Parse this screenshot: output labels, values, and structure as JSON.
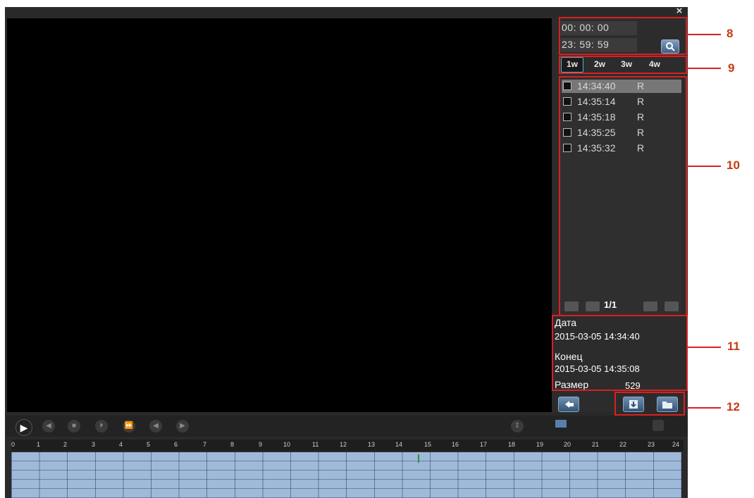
{
  "window": {
    "close_glyph": "×"
  },
  "search": {
    "start_time": "00: 00: 00",
    "end_time": "23: 59: 59",
    "search_icon": "search-icon"
  },
  "week_tabs": [
    "1w",
    "2w",
    "3w",
    "4w"
  ],
  "records": [
    {
      "time": "14:34:40",
      "flag": "R"
    },
    {
      "time": "14:35:14",
      "flag": "R"
    },
    {
      "time": "14:35:18",
      "flag": "R"
    },
    {
      "time": "14:35:25",
      "flag": "R"
    },
    {
      "time": "14:35:32",
      "flag": "R"
    }
  ],
  "pager": {
    "label": "1/1"
  },
  "info": {
    "date_label": "Дата",
    "date_value": "2015-03-05 14:34:40",
    "end_label": "Конец",
    "end_value": "2015-03-05 14:35:08",
    "size_label": "Размер",
    "size_value": "529"
  },
  "callouts": [
    "8",
    "9",
    "10",
    "11",
    "12"
  ],
  "timeline": {
    "ticks": [
      "0",
      "1",
      "2",
      "3",
      "4",
      "5",
      "6",
      "7",
      "8",
      "9",
      "10",
      "11",
      "12",
      "13",
      "14",
      "15",
      "16",
      "17",
      "18",
      "19",
      "20",
      "21",
      "22",
      "23",
      "24"
    ]
  },
  "colors": {
    "highlight": "#d92020",
    "accent": "#4fb5d2",
    "timeline_fill": "#9fb9d8"
  }
}
